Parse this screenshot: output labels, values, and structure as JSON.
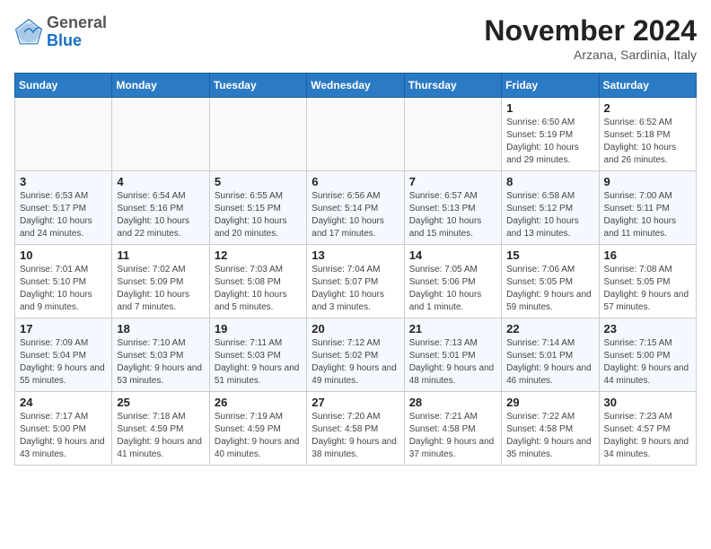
{
  "header": {
    "logo": {
      "general": "General",
      "blue": "Blue"
    },
    "title": "November 2024",
    "location": "Arzana, Sardinia, Italy"
  },
  "weekdays": [
    "Sunday",
    "Monday",
    "Tuesday",
    "Wednesday",
    "Thursday",
    "Friday",
    "Saturday"
  ],
  "weeks": [
    [
      {
        "day": "",
        "info": ""
      },
      {
        "day": "",
        "info": ""
      },
      {
        "day": "",
        "info": ""
      },
      {
        "day": "",
        "info": ""
      },
      {
        "day": "",
        "info": ""
      },
      {
        "day": "1",
        "info": "Sunrise: 6:50 AM\nSunset: 5:19 PM\nDaylight: 10 hours and 29 minutes."
      },
      {
        "day": "2",
        "info": "Sunrise: 6:52 AM\nSunset: 5:18 PM\nDaylight: 10 hours and 26 minutes."
      }
    ],
    [
      {
        "day": "3",
        "info": "Sunrise: 6:53 AM\nSunset: 5:17 PM\nDaylight: 10 hours and 24 minutes."
      },
      {
        "day": "4",
        "info": "Sunrise: 6:54 AM\nSunset: 5:16 PM\nDaylight: 10 hours and 22 minutes."
      },
      {
        "day": "5",
        "info": "Sunrise: 6:55 AM\nSunset: 5:15 PM\nDaylight: 10 hours and 20 minutes."
      },
      {
        "day": "6",
        "info": "Sunrise: 6:56 AM\nSunset: 5:14 PM\nDaylight: 10 hours and 17 minutes."
      },
      {
        "day": "7",
        "info": "Sunrise: 6:57 AM\nSunset: 5:13 PM\nDaylight: 10 hours and 15 minutes."
      },
      {
        "day": "8",
        "info": "Sunrise: 6:58 AM\nSunset: 5:12 PM\nDaylight: 10 hours and 13 minutes."
      },
      {
        "day": "9",
        "info": "Sunrise: 7:00 AM\nSunset: 5:11 PM\nDaylight: 10 hours and 11 minutes."
      }
    ],
    [
      {
        "day": "10",
        "info": "Sunrise: 7:01 AM\nSunset: 5:10 PM\nDaylight: 10 hours and 9 minutes."
      },
      {
        "day": "11",
        "info": "Sunrise: 7:02 AM\nSunset: 5:09 PM\nDaylight: 10 hours and 7 minutes."
      },
      {
        "day": "12",
        "info": "Sunrise: 7:03 AM\nSunset: 5:08 PM\nDaylight: 10 hours and 5 minutes."
      },
      {
        "day": "13",
        "info": "Sunrise: 7:04 AM\nSunset: 5:07 PM\nDaylight: 10 hours and 3 minutes."
      },
      {
        "day": "14",
        "info": "Sunrise: 7:05 AM\nSunset: 5:06 PM\nDaylight: 10 hours and 1 minute."
      },
      {
        "day": "15",
        "info": "Sunrise: 7:06 AM\nSunset: 5:05 PM\nDaylight: 9 hours and 59 minutes."
      },
      {
        "day": "16",
        "info": "Sunrise: 7:08 AM\nSunset: 5:05 PM\nDaylight: 9 hours and 57 minutes."
      }
    ],
    [
      {
        "day": "17",
        "info": "Sunrise: 7:09 AM\nSunset: 5:04 PM\nDaylight: 9 hours and 55 minutes."
      },
      {
        "day": "18",
        "info": "Sunrise: 7:10 AM\nSunset: 5:03 PM\nDaylight: 9 hours and 53 minutes."
      },
      {
        "day": "19",
        "info": "Sunrise: 7:11 AM\nSunset: 5:03 PM\nDaylight: 9 hours and 51 minutes."
      },
      {
        "day": "20",
        "info": "Sunrise: 7:12 AM\nSunset: 5:02 PM\nDaylight: 9 hours and 49 minutes."
      },
      {
        "day": "21",
        "info": "Sunrise: 7:13 AM\nSunset: 5:01 PM\nDaylight: 9 hours and 48 minutes."
      },
      {
        "day": "22",
        "info": "Sunrise: 7:14 AM\nSunset: 5:01 PM\nDaylight: 9 hours and 46 minutes."
      },
      {
        "day": "23",
        "info": "Sunrise: 7:15 AM\nSunset: 5:00 PM\nDaylight: 9 hours and 44 minutes."
      }
    ],
    [
      {
        "day": "24",
        "info": "Sunrise: 7:17 AM\nSunset: 5:00 PM\nDaylight: 9 hours and 43 minutes."
      },
      {
        "day": "25",
        "info": "Sunrise: 7:18 AM\nSunset: 4:59 PM\nDaylight: 9 hours and 41 minutes."
      },
      {
        "day": "26",
        "info": "Sunrise: 7:19 AM\nSunset: 4:59 PM\nDaylight: 9 hours and 40 minutes."
      },
      {
        "day": "27",
        "info": "Sunrise: 7:20 AM\nSunset: 4:58 PM\nDaylight: 9 hours and 38 minutes."
      },
      {
        "day": "28",
        "info": "Sunrise: 7:21 AM\nSunset: 4:58 PM\nDaylight: 9 hours and 37 minutes."
      },
      {
        "day": "29",
        "info": "Sunrise: 7:22 AM\nSunset: 4:58 PM\nDaylight: 9 hours and 35 minutes."
      },
      {
        "day": "30",
        "info": "Sunrise: 7:23 AM\nSunset: 4:57 PM\nDaylight: 9 hours and 34 minutes."
      }
    ]
  ]
}
